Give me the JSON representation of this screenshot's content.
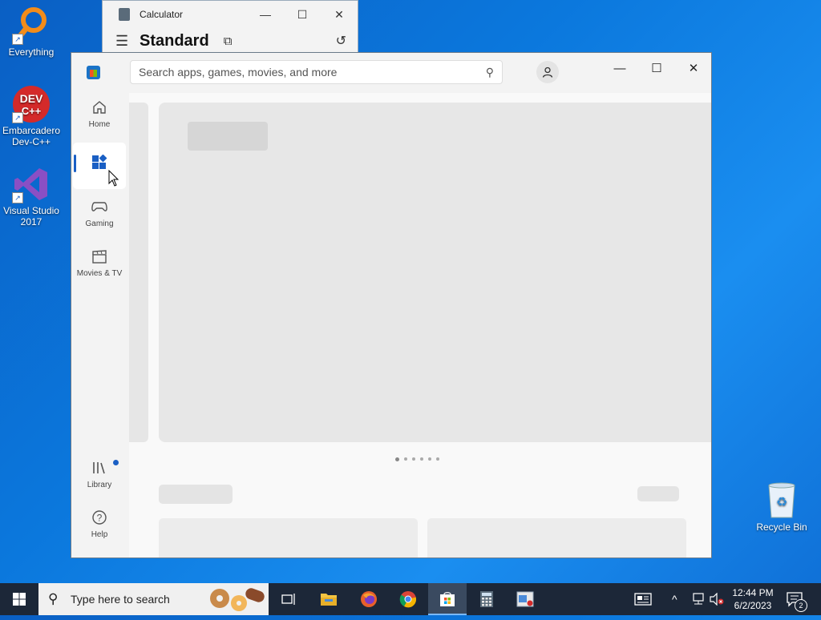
{
  "desktop": {
    "icons": [
      {
        "label": "Everything"
      },
      {
        "label": "Embarcadero Dev-C++"
      },
      {
        "label": "Visual Studio 2017"
      }
    ],
    "recycle_bin": "Recycle Bin"
  },
  "calculator": {
    "title": "Calculator",
    "mode": "Standard"
  },
  "store": {
    "search_placeholder": "Search apps, games, movies, and more",
    "nav": [
      {
        "label": "Home",
        "icon": "home-icon"
      },
      {
        "label": "",
        "icon": "apps-icon"
      },
      {
        "label": "Gaming",
        "icon": "gamepad-icon"
      },
      {
        "label": "Movies & TV",
        "icon": "clapperboard-icon"
      },
      {
        "label": "Library",
        "icon": "library-icon"
      },
      {
        "label": "Help",
        "icon": "help-icon"
      }
    ],
    "carousel_pages": 6,
    "carousel_current": 1
  },
  "taskbar": {
    "search_placeholder": "Type here to search",
    "time": "12:44 PM",
    "date": "6/2/2023",
    "notification_count": "2"
  },
  "colors": {
    "accent": "#1a5fc4",
    "taskbar": "#1c2738"
  }
}
